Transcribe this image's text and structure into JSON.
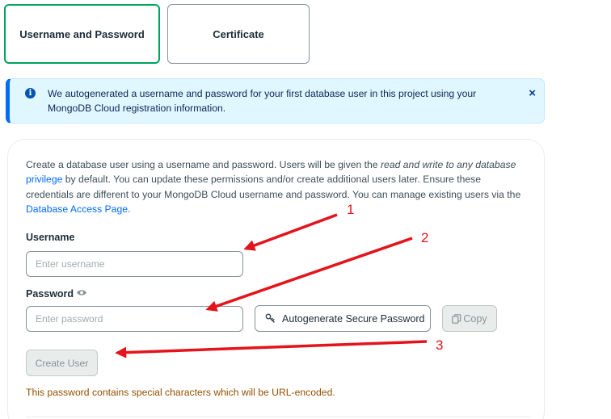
{
  "tabs": [
    {
      "label": "Username and Password",
      "active": true
    },
    {
      "label": "Certificate",
      "active": false
    }
  ],
  "banner": {
    "text": "We autogenerated a username and password for your first database user in this project using your MongoDB Cloud registration information.",
    "close_glyph": "×"
  },
  "description": {
    "part1": "Create a database user using a username and password. Users will be given the ",
    "italic": "read and write to any database",
    "link1": "privilege",
    "part2": " by default. You can update these permissions and/or create additional users later. Ensure these credentials are different to your MongoDB Cloud username and password. You can manage existing users via the ",
    "link2": "Database Access Page",
    "part3": "."
  },
  "username": {
    "label": "Username",
    "placeholder": "Enter username",
    "value": ""
  },
  "password": {
    "label": "Password",
    "placeholder": "Enter password",
    "value": ""
  },
  "buttons": {
    "autogenerate": "Autogenerate Secure Password",
    "copy": "Copy",
    "create_user": "Create User"
  },
  "warning": "This password contains special characters which will be URL-encoded.",
  "annotations": [
    "1",
    "2",
    "3"
  ],
  "colors": {
    "accent_green": "#00a35c",
    "banner_bg": "#e1f7ff",
    "link_blue": "#016bf8",
    "warning": "#944f01",
    "annotation_red": "#e3141c"
  }
}
